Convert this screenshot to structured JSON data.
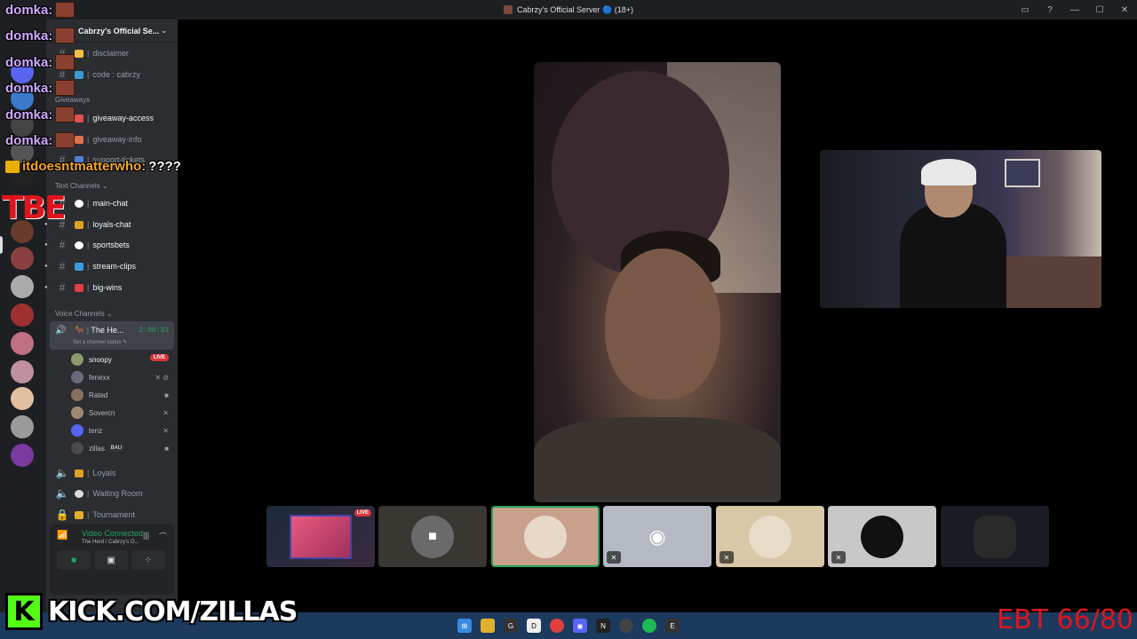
{
  "window": {
    "title": "Cabrzy's Official Server 🔵 (18+)"
  },
  "server": {
    "name": "Cabrzy's Official Se...",
    "categories": {
      "giveaways": "Giveaways",
      "text": "Text Channels",
      "voice": "Voice Channels"
    },
    "top_channels": [
      {
        "name": "disclaimer"
      },
      {
        "name": "code : cabrzy"
      }
    ],
    "giveaway_channels": [
      {
        "name": "giveaway-access"
      },
      {
        "name": "giveaway-info"
      },
      {
        "name": "support-tickets"
      }
    ],
    "text_channels": [
      {
        "name": "main-chat"
      },
      {
        "name": "loyals-chat"
      },
      {
        "name": "sportsbets"
      },
      {
        "name": "stream-clips"
      },
      {
        "name": "big-wins"
      }
    ],
    "active_voice": {
      "name": "The He...",
      "timer": "2:00:31",
      "status": "Set a channel status"
    },
    "members": [
      {
        "name": "snoopy",
        "badge": "LIVE",
        "color": "#8a9a6a"
      },
      {
        "name": "fenexx",
        "color": "#6a6a7a"
      },
      {
        "name": "Rated",
        "color": "#8a7060"
      },
      {
        "name": "Sovercn",
        "color": "#a08a70"
      },
      {
        "name": "tenz",
        "color": "#5865f2"
      },
      {
        "name": "zillas",
        "tag": "BAU",
        "color": "#4a4a4a"
      }
    ],
    "other_voice": [
      {
        "name": "Loyals"
      },
      {
        "name": "Waiting Room"
      },
      {
        "name": "Tournament"
      }
    ]
  },
  "voice_panel": {
    "label": "Video Connected",
    "sub": "The Herd / Cabrzy's O..."
  },
  "overlay_chat": [
    {
      "user": "domka:"
    },
    {
      "user": "domka:"
    },
    {
      "user": "domka:"
    },
    {
      "user": "domka:"
    },
    {
      "user": "domka:"
    },
    {
      "user": "domka:"
    }
  ],
  "overlay_last": {
    "user": "itdoesntmatterwho:",
    "msg": "????"
  },
  "overlay_tag": "TBE",
  "tiles": {
    "live": "LIVE"
  },
  "stream": {
    "kick_letter": "K",
    "kick_url": "KICK.COM/ZILLAS",
    "counter": "EBT 66/80"
  },
  "colors": {
    "accent_green": "#23a55a",
    "live_red": "#da373c",
    "kick_green": "#53fc18"
  }
}
